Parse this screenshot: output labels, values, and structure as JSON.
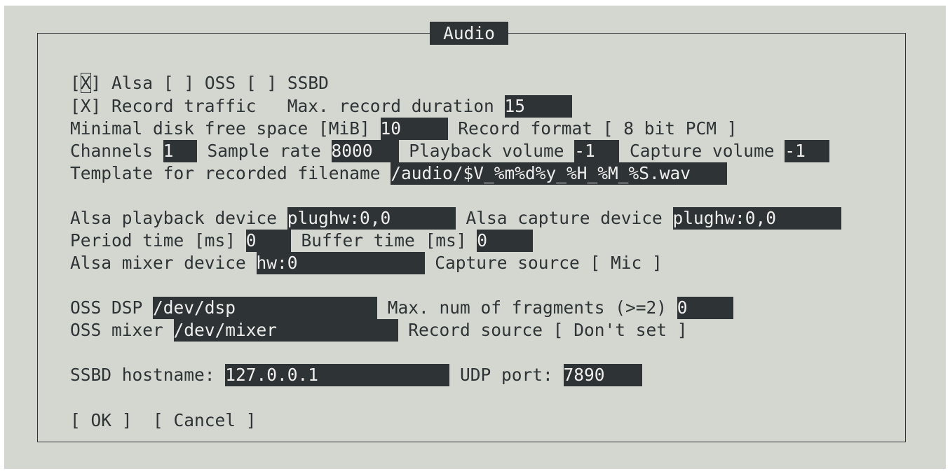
{
  "dialog": {
    "title": "Audio"
  },
  "row1": {
    "alsa_open": "[",
    "alsa_mark": "X",
    "alsa_close": "]",
    "alsa_label": " Alsa ",
    "oss": "[ ]",
    "oss_label": " OSS ",
    "ssbd": "[ ]",
    "ssbd_label": " SSBD"
  },
  "row2": {
    "record_traffic": "[X] Record traffic",
    "max_duration_label": "   Max. record duration ",
    "max_duration_value": "15"
  },
  "row3": {
    "min_disk_label": "Minimal disk free space [MiB] ",
    "min_disk_value": "10",
    "record_format_label": " Record format ",
    "record_format_value": "[ 8 bit PCM ]"
  },
  "row4": {
    "channels_label": "Channels ",
    "channels_value": "1",
    "sample_rate_label": " Sample rate ",
    "sample_rate_value": "8000",
    "playback_volume_label": " Playback volume ",
    "playback_volume_value": "-1",
    "capture_volume_label": " Capture volume ",
    "capture_volume_value": "-1"
  },
  "row5": {
    "template_label": "Template for recorded filename ",
    "template_value": "/audio/$V_%m%d%y_%H_%M_%S.wav"
  },
  "row6": {
    "alsa_playback_label": "Alsa playback device ",
    "alsa_playback_value": "plughw:0,0",
    "alsa_capture_label": " Alsa capture device ",
    "alsa_capture_value": "plughw:0,0"
  },
  "row7": {
    "period_label": "Period time [ms] ",
    "period_value": "0",
    "buffer_label": " Buffer time [ms] ",
    "buffer_value": "0"
  },
  "row8": {
    "mixer_label": "Alsa mixer device ",
    "mixer_value": "hw:0",
    "capture_source_label": " Capture source ",
    "capture_source_value": "[ Mic ]"
  },
  "row9": {
    "oss_dsp_label": "OSS DSP ",
    "oss_dsp_value": "/dev/dsp",
    "fragments_label": " Max. num of fragments (>=2) ",
    "fragments_value": "0"
  },
  "row10": {
    "oss_mixer_label": "OSS mixer ",
    "oss_mixer_value": "/dev/mixer",
    "record_source_label": " Record source ",
    "record_source_value": "[ Don't set ]"
  },
  "row11": {
    "ssbd_host_label": "SSBD hostname: ",
    "ssbd_host_value": "127.0.0.1",
    "udp_label": " UDP port: ",
    "udp_value": "7890"
  },
  "buttons": {
    "ok": "[ OK ]",
    "cancel": "[ Cancel ]"
  },
  "colors": {
    "background": "#d3d7cf",
    "foreground": "#2e3436",
    "field_text": "#eeeeec"
  }
}
